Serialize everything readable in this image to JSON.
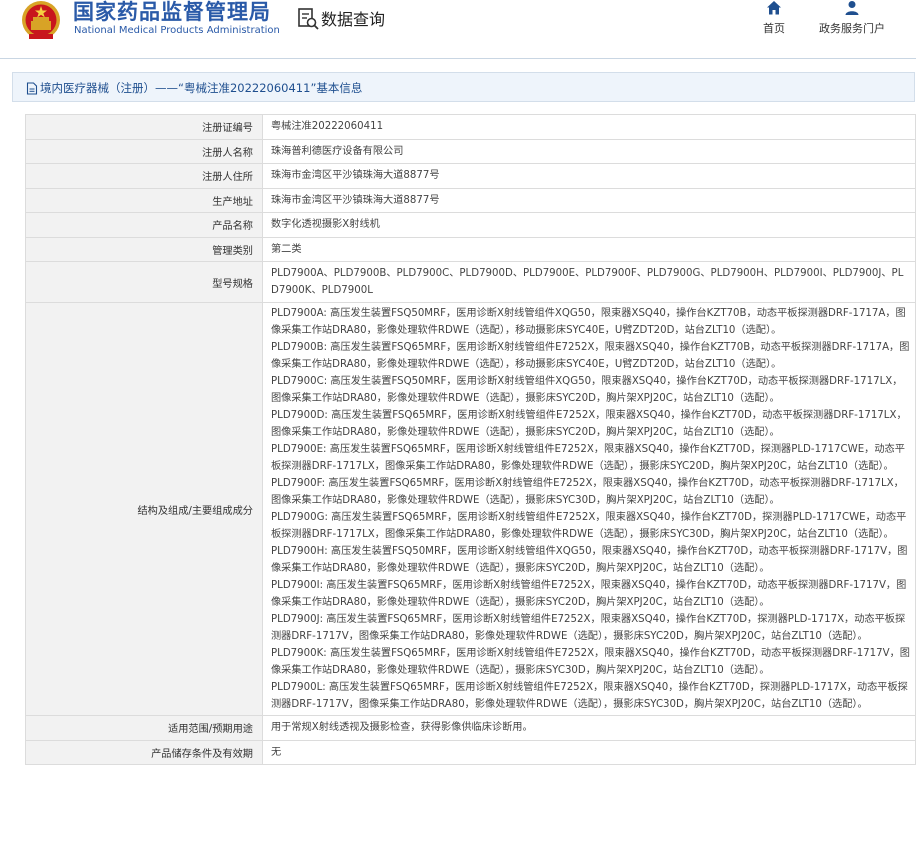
{
  "header": {
    "brand_cn": "国家药品监督管理局",
    "brand_en": "National Medical Products Administration",
    "query_title": "数据查询",
    "nav": [
      {
        "label": "首页",
        "icon": "home-icon"
      },
      {
        "label": "政务服务门户",
        "icon": "user-icon"
      }
    ],
    "brand_color": "#2a5aa8"
  },
  "breadcrumb": {
    "text": "境内医疗器械（注册）——“粤械注准20222060411”基本信息"
  },
  "table": {
    "rows": [
      {
        "label": "注册证编号",
        "value": "粤械注准20222060411"
      },
      {
        "label": "注册人名称",
        "value": "珠海普利德医疗设备有限公司"
      },
      {
        "label": "注册人住所",
        "value": "珠海市金湾区平沙镇珠海大道8877号"
      },
      {
        "label": "生产地址",
        "value": "珠海市金湾区平沙镇珠海大道8877号"
      },
      {
        "label": "产品名称",
        "value": "数字化透视摄影X射线机"
      },
      {
        "label": "管理类别",
        "value": "第二类"
      },
      {
        "label": "型号规格",
        "value": "PLD7900A、PLD7900B、PLD7900C、PLD7900D、PLD7900E、PLD7900F、PLD7900G、PLD7900H、PLD7900I、PLD7900J、PLD7900K、PLD7900L"
      }
    ],
    "structure": {
      "label": "结构及组成/主要组成成分",
      "items": [
        "PLD7900A: 高压发生装置FSQ50MRF，医用诊断X射线管组件XQG50，限束器XSQ40，操作台KZT70B，动态平板探测器DRF-1717A，图像采集工作站DRA80，影像处理软件RDWE（选配），移动摄影床SYC40E，U臂ZDT20D，站台ZLT10（选配）。",
        "PLD7900B: 高压发生装置FSQ65MRF，医用诊断X射线管组件E7252X，限束器XSQ40，操作台KZT70B，动态平板探测器DRF-1717A，图像采集工作站DRA80，影像处理软件RDWE（选配），移动摄影床SYC40E，U臂ZDT20D，站台ZLT10（选配）。",
        "PLD7900C: 高压发生装置FSQ50MRF，医用诊断X射线管组件XQG50，限束器XSQ40，操作台KZT70D，动态平板探测器DRF-1717LX，图像采集工作站DRA80，影像处理软件RDWE（选配），摄影床SYC20D，胸片架XPJ20C，站台ZLT10（选配）。",
        "PLD7900D: 高压发生装置FSQ65MRF，医用诊断X射线管组件E7252X，限束器XSQ40，操作台KZT70D，动态平板探测器DRF-1717LX，图像采集工作站DRA80，影像处理软件RDWE（选配），摄影床SYC20D，胸片架XPJ20C，站台ZLT10（选配）。",
        "PLD7900E: 高压发生装置FSQ65MRF，医用诊断X射线管组件E7252X，限束器XSQ40，操作台KZT70D，探测器PLD-1717CWE，动态平板探测器DRF-1717LX，图像采集工作站DRA80，影像处理软件RDWE（选配），摄影床SYC20D，胸片架XPJ20C，站台ZLT10（选配）。",
        "PLD7900F: 高压发生装置FSQ65MRF，医用诊断X射线管组件E7252X，限束器XSQ40，操作台KZT70D，动态平板探测器DRF-1717LX，图像采集工作站DRA80，影像处理软件RDWE（选配），摄影床SYC30D，胸片架XPJ20C，站台ZLT10（选配）。",
        "PLD7900G: 高压发生装置FSQ65MRF，医用诊断X射线管组件E7252X，限束器XSQ40，操作台KZT70D，探测器PLD-1717CWE，动态平板探测器DRF-1717LX，图像采集工作站DRA80，影像处理软件RDWE（选配），摄影床SYC30D，胸片架XPJ20C，站台ZLT10（选配）。",
        "PLD7900H: 高压发生装置FSQ50MRF，医用诊断X射线管组件XQG50，限束器XSQ40，操作台KZT70D，动态平板探测器DRF-1717V，图像采集工作站DRA80，影像处理软件RDWE（选配），摄影床SYC20D，胸片架XPJ20C，站台ZLT10（选配）。",
        "PLD7900I: 高压发生装置FSQ65MRF，医用诊断X射线管组件E7252X，限束器XSQ40，操作台KZT70D，动态平板探测器DRF-1717V，图像采集工作站DRA80，影像处理软件RDWE（选配），摄影床SYC20D，胸片架XPJ20C，站台ZLT10（选配）。",
        "PLD7900J: 高压发生装置FSQ65MRF，医用诊断X射线管组件E7252X，限束器XSQ40，操作台KZT70D，探测器PLD-1717X，动态平板探测器DRF-1717V，图像采集工作站DRA80，影像处理软件RDWE（选配），摄影床SYC20D，胸片架XPJ20C，站台ZLT10（选配）。",
        "PLD7900K: 高压发生装置FSQ65MRF，医用诊断X射线管组件E7252X，限束器XSQ40，操作台KZT70D，动态平板探测器DRF-1717V，图像采集工作站DRA80，影像处理软件RDWE（选配），摄影床SYC30D，胸片架XPJ20C，站台ZLT10（选配）。",
        "PLD7900L: 高压发生装置FSQ65MRF，医用诊断X射线管组件E7252X，限束器XSQ40，操作台KZT70D，探测器PLD-1717X，动态平板探测器DRF-1717V，图像采集工作站DRA80，影像处理软件RDWE（选配），摄影床SYC30D，胸片架XPJ20C，站台ZLT10（选配）。"
      ]
    },
    "tail_rows": [
      {
        "label": "适用范围/预期用途",
        "value": "用于常规X射线透视及摄影检查，获得影像供临床诊断用。"
      },
      {
        "label": "产品储存条件及有效期",
        "value": "无"
      }
    ]
  }
}
